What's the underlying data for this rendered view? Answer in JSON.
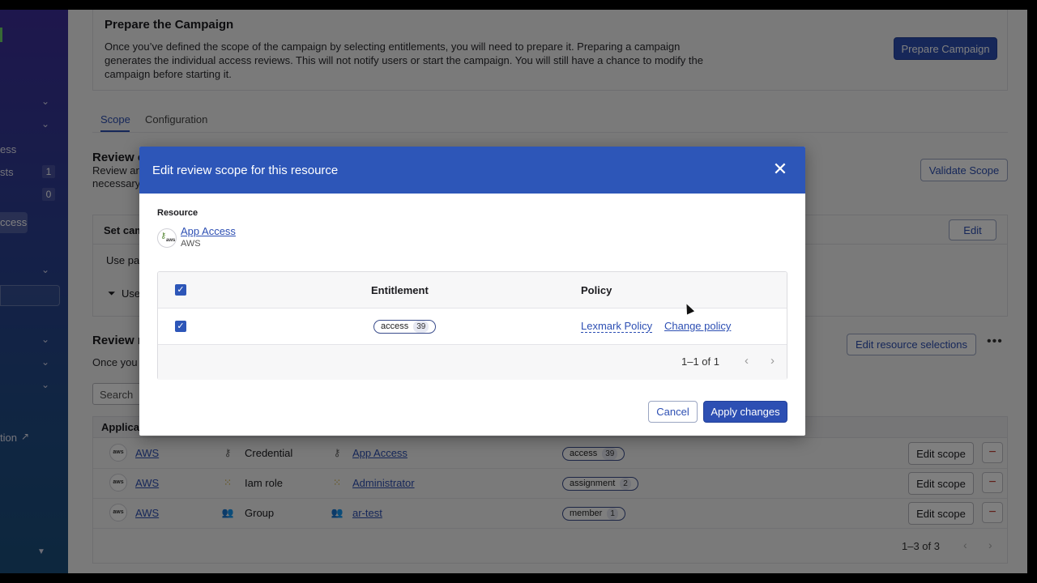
{
  "sidebar": {
    "items": [
      {
        "label": "",
        "chevron": "chevron-down-icon"
      },
      {
        "label": "",
        "chevron": "chevron-down-icon"
      },
      {
        "label": "ess"
      },
      {
        "label": "sts",
        "count": "1"
      },
      {
        "label": "",
        "count": "0"
      },
      {
        "label": "ccess"
      },
      {
        "label": "",
        "chevron": "chevron-down-icon"
      },
      {
        "label": "",
        "chevron": "chevron-down-icon"
      },
      {
        "label": "",
        "chevron": "chevron-down-icon"
      },
      {
        "label": "",
        "chevron": "chevron-down-icon"
      },
      {
        "label": "tion"
      }
    ]
  },
  "prepare": {
    "title": "Prepare the Campaign",
    "description": "Once you’ve defined the scope of the campaign by selecting entitlements, you will need to prepare it. Preparing a campaign generates the individual access reviews. This will not notify users or start the campaign. You will still have a chance to modify the campaign before starting it.",
    "button": "Prepare Campaign"
  },
  "tabs": [
    "Scope",
    "Configuration"
  ],
  "scope_section": {
    "title": "Review c",
    "desc_line1": "Review an",
    "desc_line2": "necessary",
    "validate_button": "Validate Scope",
    "card_title": "Set cam",
    "edit_button": "Edit",
    "line1": "Use pa",
    "line2": "Use"
  },
  "resources_section": {
    "title": "Review r",
    "desc": "Once you",
    "search_placeholder": "Search",
    "edit_selections_button": "Edit resource selections",
    "table_header": "Applicat",
    "rows": [
      {
        "app": "AWS",
        "type": "Credential",
        "resource": "App Access",
        "entitlement": "access",
        "count": "39",
        "action": "Edit scope"
      },
      {
        "app": "AWS",
        "type": "Iam role",
        "resource": "Administrator",
        "entitlement": "assignment",
        "count": "2",
        "action": "Edit scope"
      },
      {
        "app": "AWS",
        "type": "Group",
        "resource": "ar-test",
        "entitlement": "member",
        "count": "1",
        "action": "Edit scope"
      }
    ],
    "pager": "1–3 of 3"
  },
  "modal": {
    "title": "Edit review scope for this resource",
    "resource_label": "Resource",
    "resource_name": "App Access",
    "resource_sub": "AWS",
    "col_entitlement": "Entitlement",
    "col_policy": "Policy",
    "row": {
      "entitlement": "access",
      "count": "39",
      "policy": "Lexmark Policy",
      "change": "Change policy"
    },
    "pager": "1–1 of 1",
    "cancel": "Cancel",
    "apply": "Apply changes"
  },
  "colors": {
    "accent": "#2d56b8",
    "link": "#2d4fb3",
    "danger": "#c0392b"
  }
}
